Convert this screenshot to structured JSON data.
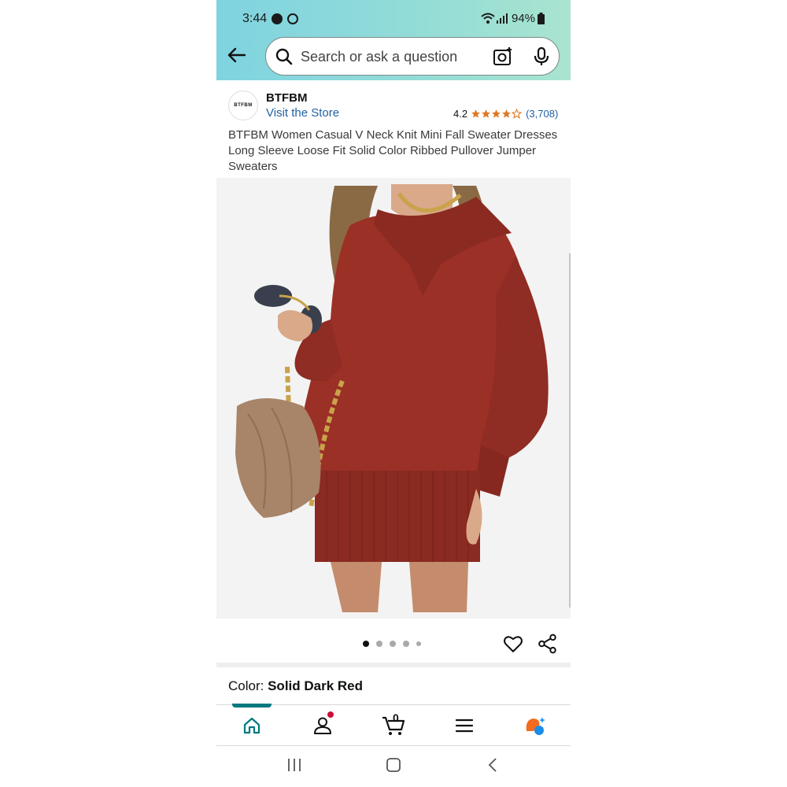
{
  "status_bar": {
    "time": "3:44",
    "battery": "94%",
    "icons": [
      "messenger-icon",
      "app-icon",
      "wifi-icon",
      "signal-icon",
      "battery-icon"
    ]
  },
  "header": {
    "back_icon": "arrow-left-icon",
    "search_placeholder": "Search or ask a question",
    "camera_icon": "camera-plus-icon",
    "mic_icon": "microphone-icon",
    "gradient_colors": [
      "#7fd3e0",
      "#a9e4cf"
    ]
  },
  "product": {
    "brand_logo_text": "BTFBM",
    "brand": "BTFBM",
    "visit_store": "Visit the Store",
    "rating": "4.2",
    "rating_stars": 4.2,
    "review_count": "(3,708)",
    "title": "BTFBM Women Casual V Neck Knit Mini Fall Sweater Dresses Long Sleeve Loose Fit Solid Color Ribbed Pullover Jumper Sweaters",
    "image_alt": "Woman wearing dark red knit sweater dress holding sunglasses and a tan chain bag",
    "image_dots": 5,
    "active_image": 1,
    "color_label": "Color:",
    "color_value": "Solid Dark Red",
    "dress_color": "#9b3026",
    "star_color": "#de7921"
  },
  "bottom_nav": {
    "items": [
      "home-icon",
      "account-icon",
      "cart-icon",
      "menu-icon",
      "rufus-icon"
    ],
    "cart_count": "0",
    "accent": "#00797f"
  },
  "system_nav": [
    "recents-icon",
    "home-button-icon",
    "back-icon"
  ]
}
